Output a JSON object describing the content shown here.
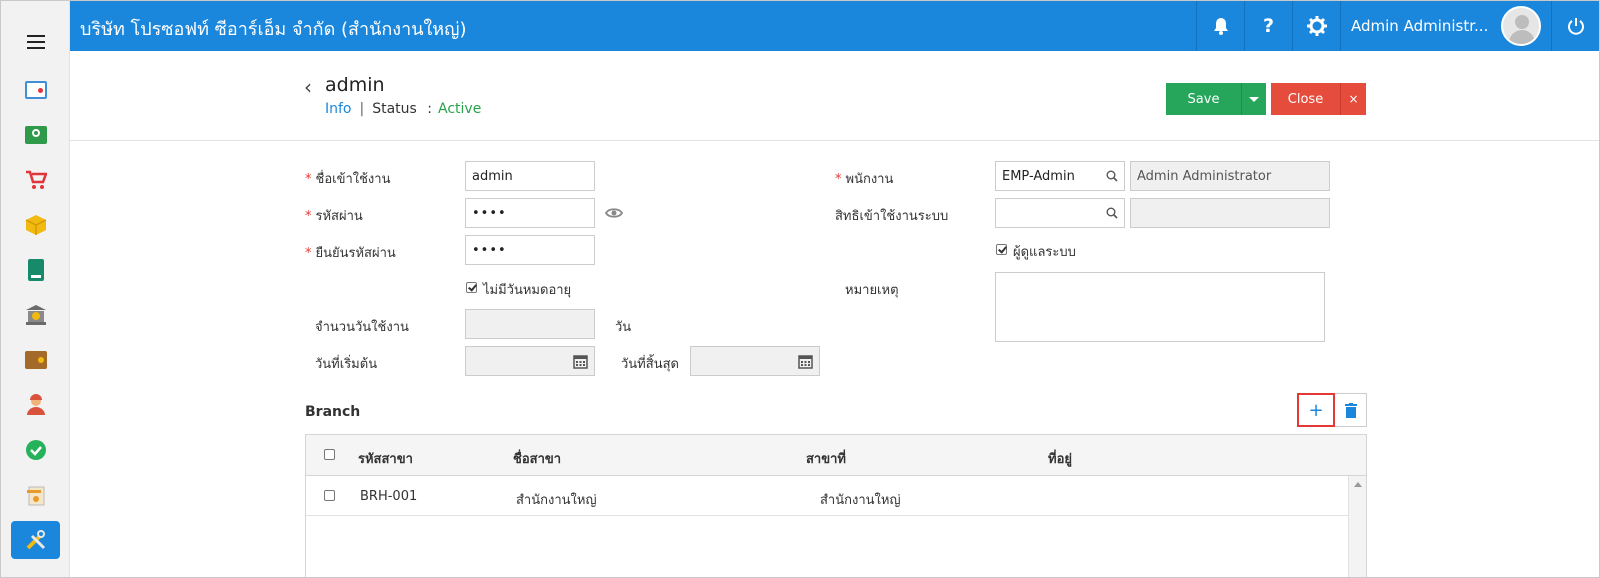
{
  "topbar": {
    "company": "บริษัท โปรซอฟท์ ซีอาร์เอ็ม จำกัด (สำนักงานใหญ่)",
    "user_name": "Admin Administr...",
    "icons": [
      "bell-icon",
      "help-icon",
      "gear-icon",
      "avatar",
      "power-icon"
    ]
  },
  "sidebar": {
    "items": [
      {
        "name": "dashboard-icon",
        "color": "#3f8fd8"
      },
      {
        "name": "money-icon",
        "color": "#2e9a4a"
      },
      {
        "name": "cart-icon",
        "color": "#e0353a"
      },
      {
        "name": "box-icon",
        "color": "#f2b90f"
      },
      {
        "name": "book-icon",
        "color": "#168a6a"
      },
      {
        "name": "bank-icon",
        "color": "#6b6b6b"
      },
      {
        "name": "wallet-icon",
        "color": "#a46a2a"
      },
      {
        "name": "people-icon",
        "color": "#d9533c"
      },
      {
        "name": "check-icon",
        "color": "#25b25b"
      },
      {
        "name": "report-icon",
        "color": "#e59a2a"
      },
      {
        "name": "tools-icon",
        "color": "#1a87dc"
      }
    ]
  },
  "header": {
    "title": "admin",
    "info_label": "Info",
    "separator": "|",
    "status_label": "Status",
    "colon": ":",
    "status_value": "Active",
    "save_label": "Save",
    "close_label": "Close",
    "close_x": "×"
  },
  "form": {
    "username_label": "ชื่อเข้าใช้งาน",
    "username_value": "admin",
    "password_label": "รหัสผ่าน",
    "password_value": "••••",
    "confirm_label": "ยืนยันรหัสผ่าน",
    "confirm_value": "••••",
    "no_expire_label": "ไม่มีวันหมดอายุ",
    "days_label": "จำนวนวันใช้งาน",
    "days_unit": "วัน",
    "start_label": "วันที่เริ่มต้น",
    "end_label": "วันที่สิ้นสุด",
    "employee_label": "พนักงาน",
    "employee_code": "EMP-Admin",
    "employee_name": "Admin Administrator",
    "permission_label": "สิทธิเข้าใช้งานระบบ",
    "admin_label": "ผู้ดูแลระบบ",
    "note_label": "หมายเหตุ",
    "required_mark": "*"
  },
  "branch": {
    "title": "Branch",
    "add_label": "+",
    "columns": [
      "รหัสสาขา",
      "ชื่อสาขา",
      "สาขาที่",
      "ที่อยู่"
    ],
    "rows": [
      {
        "code": "BRH-001",
        "name": "สำนักงานใหญ่",
        "branch_no": "สำนักงานใหญ่",
        "address": ""
      }
    ]
  }
}
